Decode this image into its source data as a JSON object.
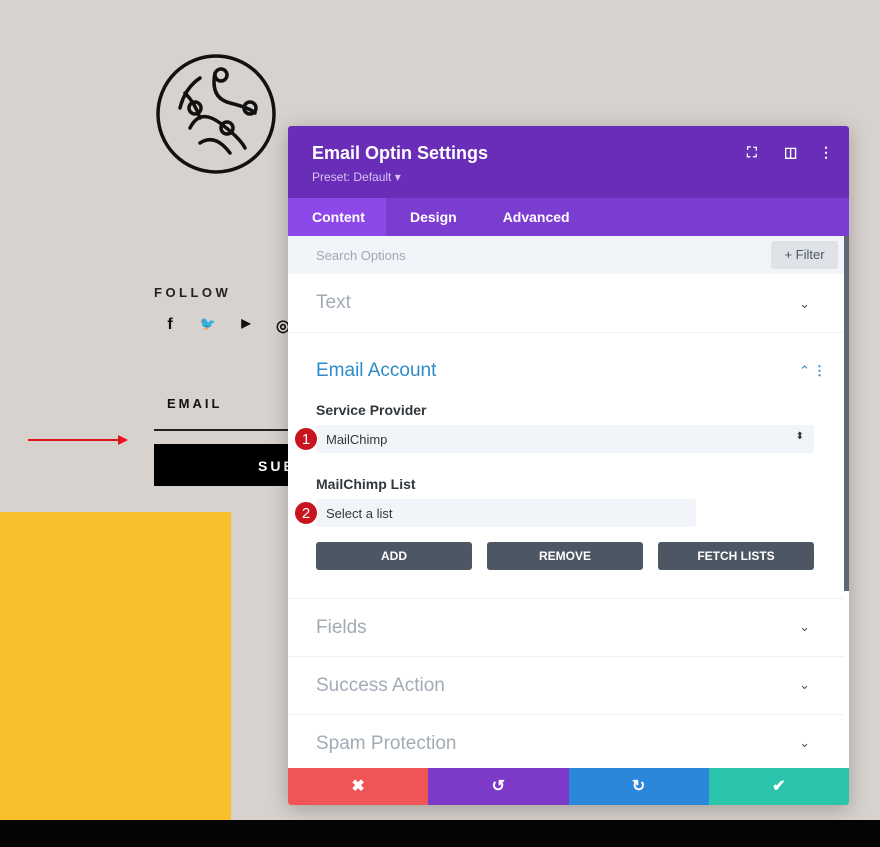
{
  "page": {
    "follow": "FOLLOW",
    "social": [
      {
        "icon": "facebook-icon",
        "glyph": "f"
      },
      {
        "icon": "twitter-icon",
        "glyph": "🐦"
      },
      {
        "icon": "youtube-icon",
        "glyph": "▶"
      },
      {
        "icon": "instagram-icon",
        "glyph": "◎"
      }
    ],
    "email_label": "EMAIL",
    "subscribe_label": "SUB"
  },
  "modal": {
    "title": "Email Optin Settings",
    "preset": "Preset: Default ▾",
    "tabs": [
      "Content",
      "Design",
      "Advanced"
    ],
    "search_placeholder": "Search Options",
    "filter_label": "+ Filter",
    "sections": {
      "text": "Text",
      "email_account": "Email Account",
      "fields": "Fields",
      "success_action": "Success Action",
      "spam_protection": "Spam Protection"
    },
    "service_provider_label": "Service Provider",
    "service_provider_value": "MailChimp",
    "list_label": "MailChimp List",
    "list_value": "Select a list",
    "badges": [
      "1",
      "2"
    ],
    "buttons": {
      "add": "ADD",
      "remove": "REMOVE",
      "fetch": "FETCH LISTS"
    },
    "footer": {
      "cancel": "✖",
      "undo": "↺",
      "redo": "↻",
      "save": "✔"
    }
  },
  "colors": {
    "header": "#6a2db7",
    "tabs": "#7b3cd0",
    "cancel": "#ef5555",
    "undo": "#7d3ac9",
    "redo": "#2b87da",
    "save": "#29c4a9",
    "accent_yellow": "#f9bf2c"
  }
}
